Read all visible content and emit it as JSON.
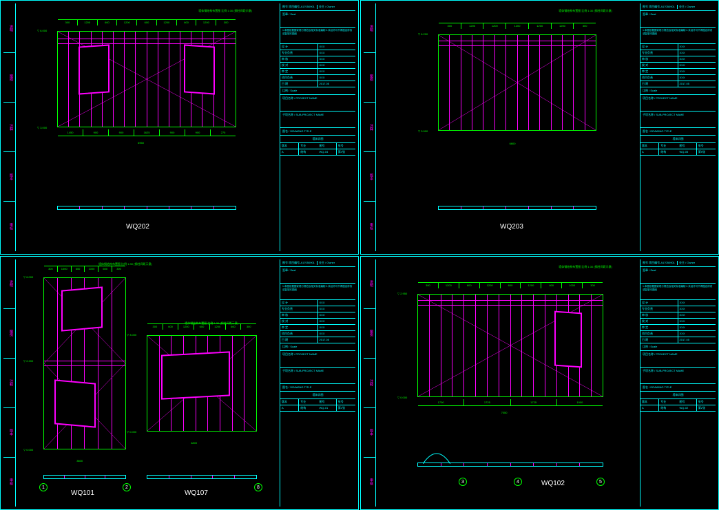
{
  "sheets": [
    {
      "panel_id": "WQ202",
      "panel_label": "WQ202",
      "left_strip": [
        "说明",
        "图例",
        "注释",
        "版本",
        "审核"
      ],
      "dwg_note_top": "墙体钢结构布置图  比例 1:30 (钢柱间距示意)",
      "levels": {
        "top": "6.000",
        "bot": "3.000"
      },
      "dims_top": [
        "300",
        "1200",
        "600",
        "1200",
        "600",
        "1200",
        "600",
        "1200",
        "300"
      ],
      "dims_bot": [
        "1450",
        "900",
        "900",
        "1625",
        "900",
        "900",
        "275"
      ],
      "dims_bot_total": "6950",
      "titleblock": {
        "header": "图号    项目编号-A17050901",
        "owner": "业主 / Owner",
        "seal": "签章 / Seal",
        "note": "1.本图依据国家现行规范及相关标准编制\n2.未经许可不得擅自修改或复制本图纸",
        "info_rows": [
          [
            "设 计",
            "XXX"
          ],
          [
            "专业负责",
            "XXX"
          ],
          [
            "审 核",
            "XXX"
          ],
          [
            "校 对",
            "XXX"
          ],
          [
            "审 定",
            "XXX"
          ],
          [
            "项目负责",
            "XXX"
          ],
          [
            "日 期",
            "2017.05"
          ]
        ],
        "scale_label": "比例 / Scale",
        "project_label": "项目名称 / PROJECT NAME",
        "subproject_label": "子项名称 / SUB-PROJECT NAME",
        "dwg_title_label": "图名 / DRAWING TITLE",
        "dwg_title": "墙体详图",
        "footer": [
          [
            "版本",
            "专业",
            "图号",
            "张号"
          ],
          [
            "A",
            "结构",
            "WQ-04",
            "第4张"
          ]
        ]
      }
    },
    {
      "panel_id": "WQ203",
      "panel_label": "WQ203",
      "left_strip": [
        "说明",
        "图例",
        "注释",
        "版本",
        "审核"
      ],
      "dwg_note_top": "墙体钢结构布置图  比例 1:30 (钢柱间距示意)",
      "levels": {
        "top": "6.200",
        "bot": "3.000"
      },
      "dims_top": [
        "300",
        "1200",
        "1200",
        "1200",
        "1200",
        "1200",
        "300"
      ],
      "dims_bot_total": "6600",
      "titleblock": {
        "header": "图号    项目编号-A17050901",
        "owner": "业主 / Owner",
        "seal": "签章 / Seal",
        "note": "1.本图依据国家现行规范及相关标准编制\n2.未经许可不得擅自修改或复制本图纸",
        "info_rows": [
          [
            "设 计",
            "XXX"
          ],
          [
            "专业负责",
            "XXX"
          ],
          [
            "审 核",
            "XXX"
          ],
          [
            "校 对",
            "XXX"
          ],
          [
            "审 定",
            "XXX"
          ],
          [
            "项目负责",
            "XXX"
          ],
          [
            "日 期",
            "2017.05"
          ]
        ],
        "scale_label": "比例 / Scale",
        "project_label": "项目名称 / PROJECT NAME",
        "subproject_label": "子项名称 / SUB-PROJECT NAME",
        "dwg_title_label": "图名 / DRAWING TITLE",
        "dwg_title": "墙体详图",
        "footer": [
          [
            "版本",
            "专业",
            "图号",
            "张号"
          ],
          [
            "A",
            "结构",
            "WQ-05",
            "第5张"
          ]
        ]
      }
    },
    {
      "panel_id": "WQ101_107",
      "panel_labels": [
        "WQ101",
        "WQ107"
      ],
      "left_strip": [
        "说明",
        "图例",
        "注释",
        "版本",
        "审核"
      ],
      "dwg_note_top_a": "墙体钢结构布置图  比例 1:30 (钢柱间距示意)",
      "dwg_note_top_b": "墙体钢结构布置图  比例 1:30 (钢柱间距示意)",
      "levels_a": {
        "top": "6.000",
        "mid": "2.200",
        "bot": "0.000"
      },
      "levels_b": {
        "top": "3.000",
        "bot": "0.000"
      },
      "dims_top_a": [
        "300",
        "1000",
        "600",
        "1000",
        "600",
        "300"
      ],
      "dims_top_b": [
        "300",
        "600",
        "1200",
        "600",
        "1200",
        "600",
        "300"
      ],
      "dims_bot_a_total": "3800",
      "dims_bot_b_total": "4800",
      "grid_bubbles": [
        "1",
        "2",
        "8"
      ],
      "titleblock": {
        "header": "图号    项目编号-A17050901",
        "owner": "业主 / Owner",
        "seal": "签章 / Seal",
        "note": "1.本图依据国家现行规范及相关标准编制\n2.未经许可不得擅自修改或复制本图纸",
        "info_rows": [
          [
            "设 计",
            "XXX"
          ],
          [
            "专业负责",
            "XXX"
          ],
          [
            "审 核",
            "XXX"
          ],
          [
            "校 对",
            "XXX"
          ],
          [
            "审 定",
            "XXX"
          ],
          [
            "项目负责",
            "XXX"
          ],
          [
            "日 期",
            "2017.05"
          ]
        ],
        "scale_label": "比例 / Scale",
        "project_label": "项目名称 / PROJECT NAME",
        "subproject_label": "子项名称 / SUB-PROJECT NAME",
        "dwg_title_label": "图名 / DRAWING TITLE",
        "dwg_title": "墙体详图",
        "footer": [
          [
            "版本",
            "专业",
            "图号",
            "张号"
          ],
          [
            "A",
            "结构",
            "WQ-01",
            "第1张"
          ]
        ]
      }
    },
    {
      "panel_id": "WQ102",
      "panel_label": "WQ102",
      "left_strip": [
        "说明",
        "图例",
        "注释",
        "版本",
        "审核"
      ],
      "dwg_note_top": "墙体钢结构布置图  比例 1:30 (钢柱间距示意)",
      "levels": {
        "top": "2.950",
        "bot": "0.000"
      },
      "dims_top": [
        "300",
        "1200",
        "600",
        "1200",
        "600",
        "1200",
        "600",
        "1000",
        "300"
      ],
      "dims_bot": [
        "1700",
        "1725",
        "1725",
        "1900"
      ],
      "dims_bot_total": "7050",
      "grid_bubbles": [
        "3",
        "4",
        "5"
      ],
      "titleblock": {
        "header": "图号    项目编号-A17050901",
        "owner": "业主 / Owner",
        "seal": "签章 / Seal",
        "note": "1.本图依据国家现行规范及相关标准编制\n2.未经许可不得擅自修改或复制本图纸",
        "info_rows": [
          [
            "设 计",
            "XXX"
          ],
          [
            "专业负责",
            "XXX"
          ],
          [
            "审 核",
            "XXX"
          ],
          [
            "校 对",
            "XXX"
          ],
          [
            "审 定",
            "XXX"
          ],
          [
            "项目负责",
            "XXX"
          ],
          [
            "日 期",
            "2017.05"
          ]
        ],
        "scale_label": "比例 / Scale",
        "project_label": "项目名称 / PROJECT NAME",
        "subproject_label": "子项名称 / SUB-PROJECT NAME",
        "dwg_title_label": "图名 / DRAWING TITLE",
        "dwg_title": "墙体详图",
        "footer": [
          [
            "版本",
            "专业",
            "图号",
            "张号"
          ],
          [
            "A",
            "结构",
            "WQ-02",
            "第2张"
          ]
        ]
      }
    }
  ]
}
